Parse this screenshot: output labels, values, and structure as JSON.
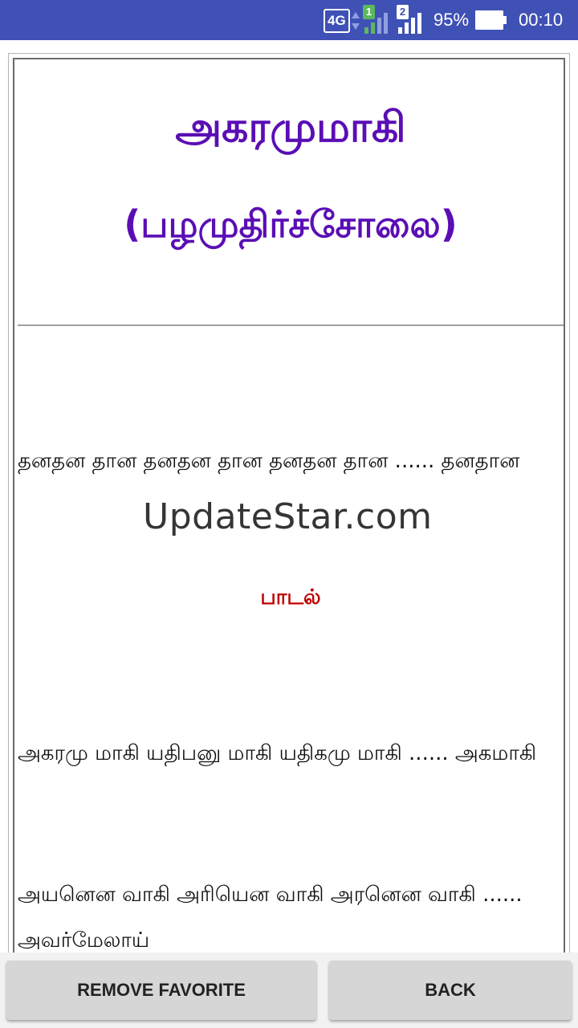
{
  "status_bar": {
    "network": "4G",
    "sim1": "1",
    "sim2": "2",
    "battery": "95%",
    "time": "00:10",
    "icons": [
      "signal-icon",
      "battery-icon"
    ]
  },
  "page": {
    "title_line1": "அகரமுமாகி",
    "title_line2": "(பழமுதிர்ச்சோலை)",
    "rhythm_line": "தனதன தான தனதன தான தனதன தான ...... தனதான",
    "song_heading": "பாடல்",
    "verse1": "அகரமு மாகி யதிபனு மாகி யதிகமு மாகி ...... அகமாகி",
    "verse2": "அயனென வாகி அரியென வாகி அரனென வாகி ...... அவர்மேலாய்"
  },
  "watermark": "UpdateStar.com",
  "buttons": {
    "remove_favorite": "REMOVE FAVORITE",
    "back": "BACK"
  },
  "colors": {
    "status_bar": "#3f51b5",
    "title": "#5a0eb4",
    "heading": "#c00000",
    "button": "#d6d6d6"
  }
}
